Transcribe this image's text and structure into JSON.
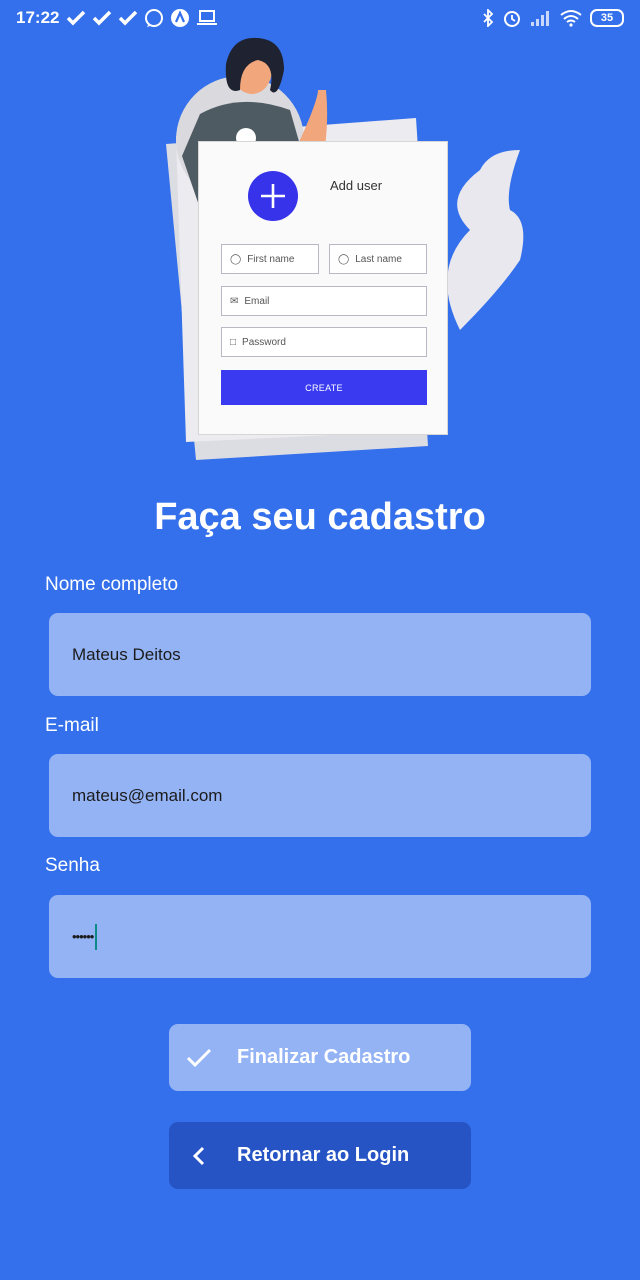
{
  "status_bar": {
    "time": "17:22",
    "battery": "35",
    "left_icons": [
      "check-icon",
      "check-icon",
      "check-icon",
      "whatsapp-icon",
      "app-icon",
      "laptop-icon"
    ],
    "right_icons": [
      "bluetooth-icon",
      "alarm-icon",
      "signal-icon",
      "wifi-icon",
      "battery-icon"
    ]
  },
  "illustration": {
    "card_title": "Add user",
    "first_name": "First name",
    "last_name": "Last name",
    "email": "Email",
    "password": "Password",
    "create": "CREATE"
  },
  "title": "Faça seu cadastro",
  "form": {
    "name_label": "Nome completo",
    "name_value": "Mateus Deitos",
    "email_label": "E-mail",
    "email_value": "mateus@email.com",
    "password_label": "Senha",
    "password_value": "••••••"
  },
  "buttons": {
    "finish": "Finalizar Cadastro",
    "back": "Retornar ao Login"
  },
  "colors": {
    "background": "#3470EB",
    "input": "#94B3F5",
    "back_button": "#2654C5",
    "illustration_accent": "#3a3af0"
  }
}
